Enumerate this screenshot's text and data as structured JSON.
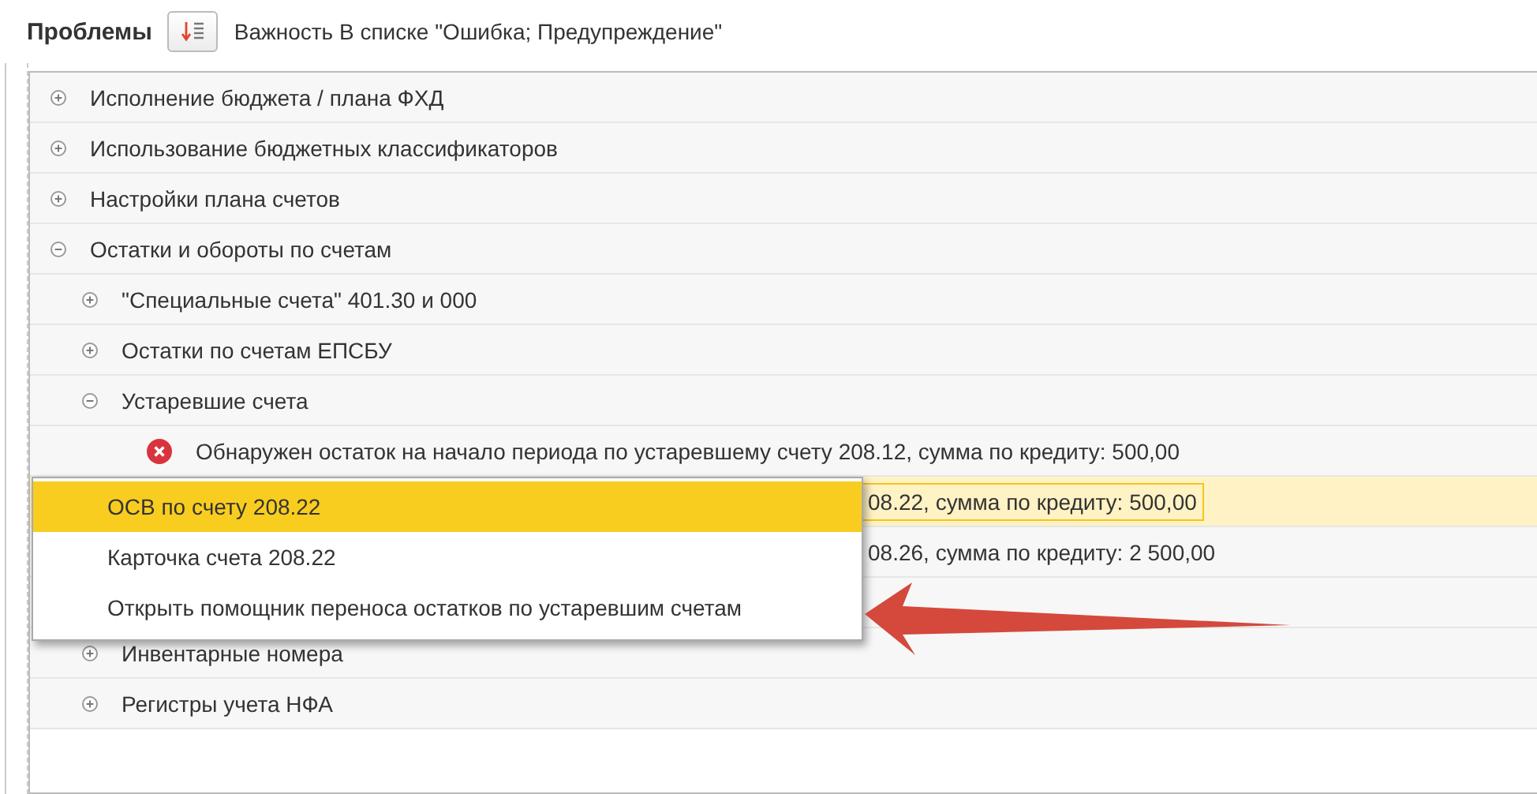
{
  "header": {
    "title": "Проблемы",
    "filter": "Важность В списке \"Ошибка; Предупреждение\""
  },
  "tree": [
    {
      "label": "Исполнение бюджета / плана ФХД",
      "expanded": false
    },
    {
      "label": "Использование бюджетных классификаторов",
      "expanded": false
    },
    {
      "label": "Настройки плана счетов",
      "expanded": false
    },
    {
      "label": "Остатки и обороты по счетам",
      "expanded": true,
      "children": [
        {
          "label": "\"Специальные счета\" 401.30 и 000",
          "expanded": false
        },
        {
          "label": "Остатки по счетам ЕПСБУ",
          "expanded": false
        },
        {
          "label": "Устаревшие счета",
          "expanded": true,
          "children": [
            {
              "kind": "error",
              "label": "Обнаружен остаток на начало периода по устаревшему счету 208.12, сумма по кредиту: 500,00",
              "selected": false
            },
            {
              "kind": "fragment",
              "label": "08.22, сумма по кредиту: 500,00",
              "selected": true
            },
            {
              "kind": "fragment",
              "label": "08.26, сумма по кредиту: 2 500,00",
              "selected": false
            }
          ]
        },
        {
          "label": "Инвентарные номера",
          "expanded": false
        },
        {
          "label": "Регистры учета НФА",
          "expanded": false
        }
      ]
    }
  ],
  "context_menu": [
    {
      "label": "ОСВ по счету 208.22",
      "selected": true
    },
    {
      "label": "Карточка счета 208.22",
      "selected": false
    },
    {
      "label": "Открыть помощник переноса остатков по устаревшим счетам",
      "selected": false
    }
  ]
}
